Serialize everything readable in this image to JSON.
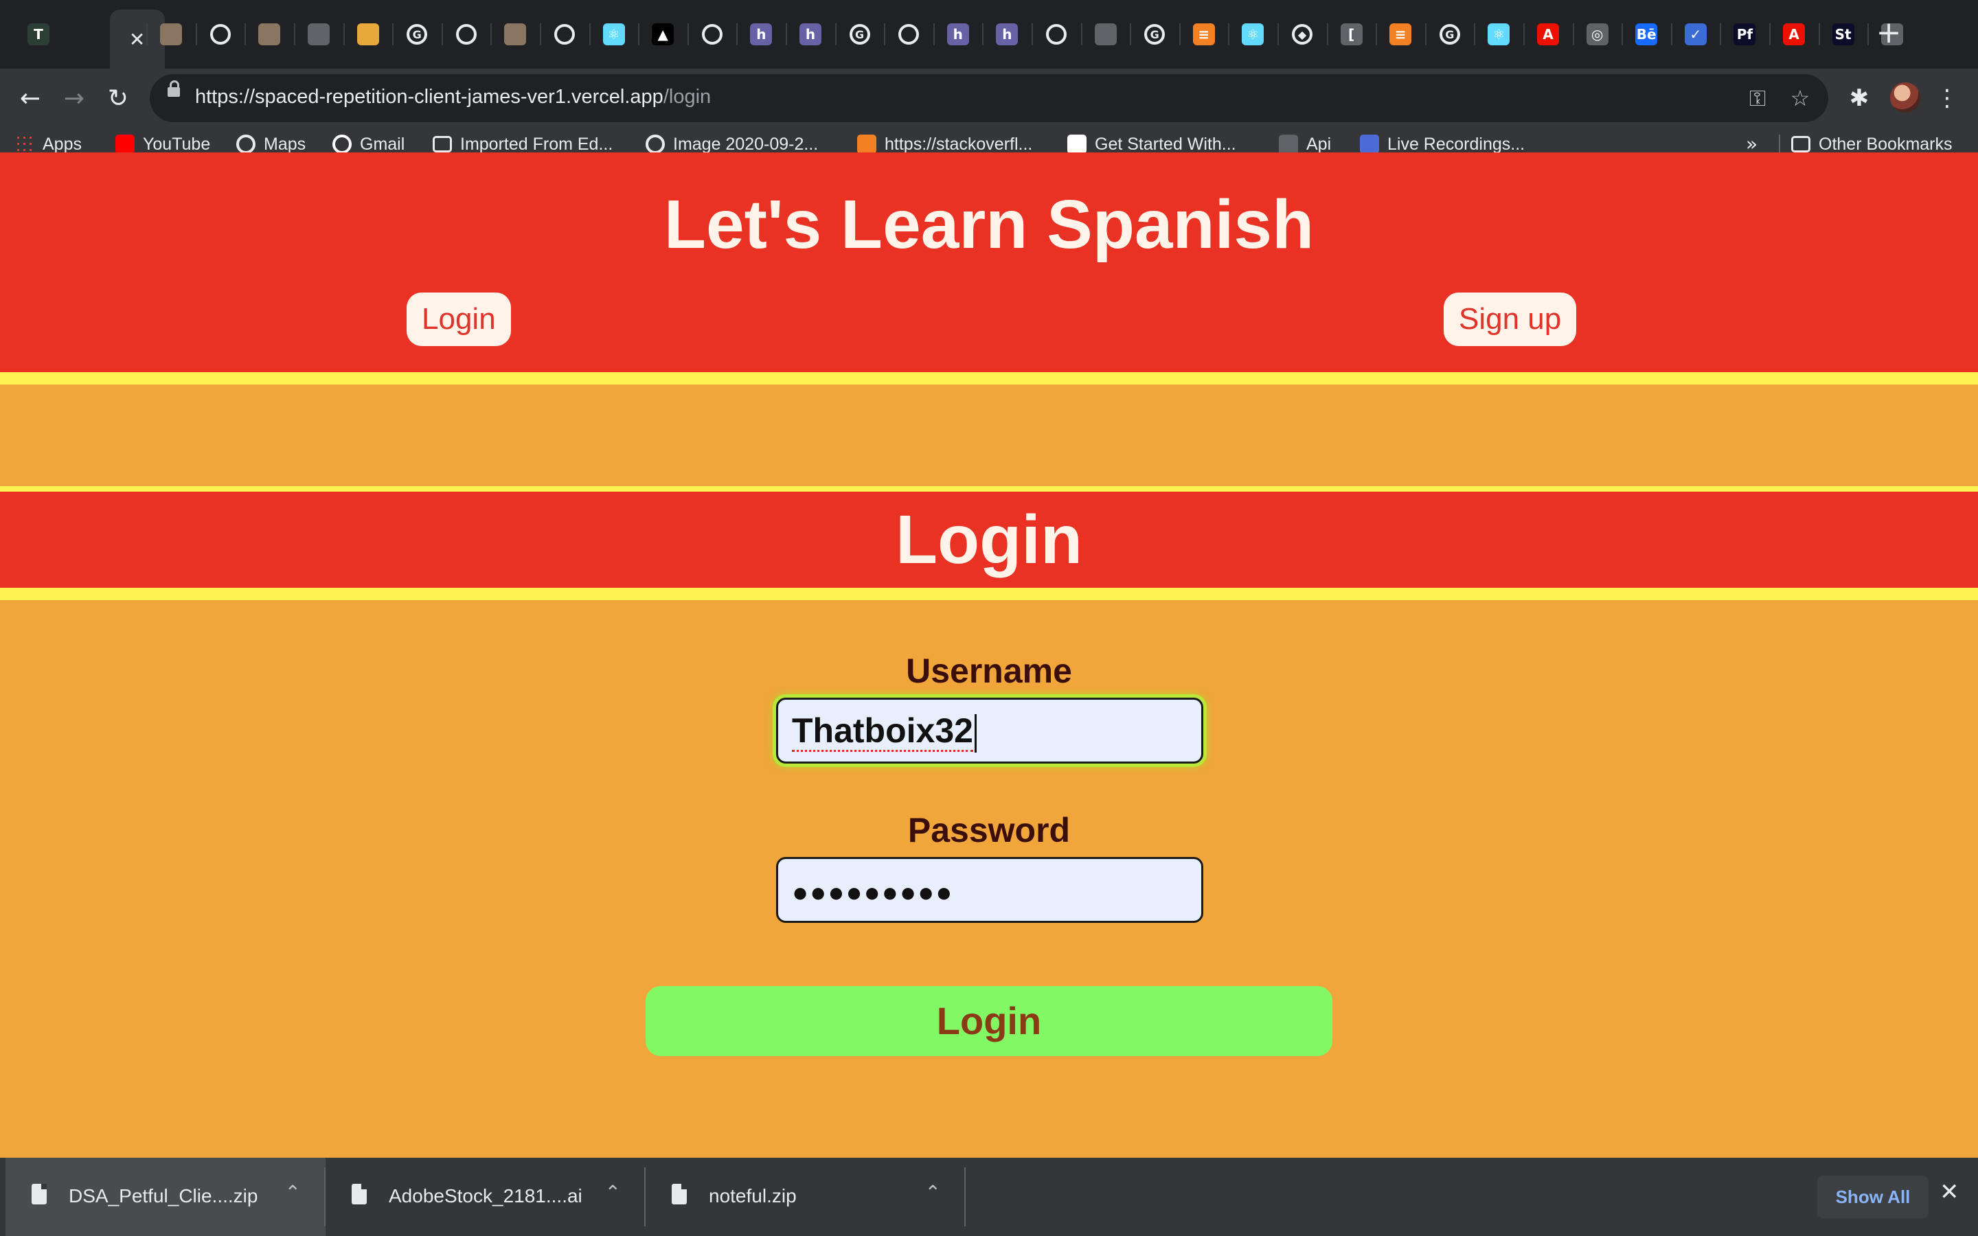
{
  "browser": {
    "tabs": [
      {
        "icon": "custom-app-icon",
        "color": "#2c3e35",
        "glyph": "T"
      },
      {
        "icon": "close-icon",
        "color": "#35363a",
        "glyph": "✕",
        "active": true
      },
      {
        "icon": "cat-photo-icon",
        "color": "#8a7560",
        "glyph": ""
      },
      {
        "icon": "github-icon",
        "color": "#ffffff",
        "glyph": ""
      },
      {
        "icon": "cat-photo-icon",
        "color": "#8a7560",
        "glyph": ""
      },
      {
        "icon": "globe-icon",
        "color": "#5f6368",
        "glyph": ""
      },
      {
        "icon": "shop-icon",
        "color": "#e8a93a",
        "glyph": ""
      },
      {
        "icon": "google-icon",
        "color": "#ffffff",
        "glyph": "G"
      },
      {
        "icon": "github-icon",
        "color": "#ffffff",
        "glyph": ""
      },
      {
        "icon": "cat-photo-icon",
        "color": "#8a7560",
        "glyph": ""
      },
      {
        "icon": "github-icon",
        "color": "#ffffff",
        "glyph": ""
      },
      {
        "icon": "react-icon",
        "color": "#61dafb",
        "glyph": "⚛"
      },
      {
        "icon": "vercel-icon",
        "color": "#000000",
        "glyph": "▲"
      },
      {
        "icon": "github-icon",
        "color": "#ffffff",
        "glyph": ""
      },
      {
        "icon": "heroku-icon",
        "color": "#6762a6",
        "glyph": "h"
      },
      {
        "icon": "heroku-icon",
        "color": "#6762a6",
        "glyph": "h"
      },
      {
        "icon": "google-icon",
        "color": "#ffffff",
        "glyph": "G"
      },
      {
        "icon": "github-icon",
        "color": "#ffffff",
        "glyph": ""
      },
      {
        "icon": "heroku-icon",
        "color": "#6762a6",
        "glyph": "h"
      },
      {
        "icon": "heroku-icon",
        "color": "#6762a6",
        "glyph": "h"
      },
      {
        "icon": "github-icon",
        "color": "#ffffff",
        "glyph": ""
      },
      {
        "icon": "globe-icon",
        "color": "#5f6368",
        "glyph": ""
      },
      {
        "icon": "google-icon",
        "color": "#ffffff",
        "glyph": "G"
      },
      {
        "icon": "stackoverflow-icon",
        "color": "#f48024",
        "glyph": "≡"
      },
      {
        "icon": "react-icon",
        "color": "#61dafb",
        "glyph": "⚛"
      },
      {
        "icon": "codepen-icon",
        "color": "#ffffff",
        "glyph": "◆"
      },
      {
        "icon": "api-icon",
        "color": "#5f6368",
        "glyph": "["
      },
      {
        "icon": "stackoverflow-icon",
        "color": "#f48024",
        "glyph": "≡"
      },
      {
        "icon": "google-icon",
        "color": "#ffffff",
        "glyph": "G"
      },
      {
        "icon": "react-icon",
        "color": "#61dafb",
        "glyph": "⚛"
      },
      {
        "icon": "adobe-icon",
        "color": "#eb1000",
        "glyph": "A"
      },
      {
        "icon": "dribbble-icon",
        "color": "#5f6368",
        "glyph": "◎"
      },
      {
        "icon": "behance-icon",
        "color": "#1769ff",
        "glyph": "Bē"
      },
      {
        "icon": "checkmark-icon",
        "color": "#3c6dd6",
        "glyph": "✓"
      },
      {
        "icon": "portfolio-icon",
        "color": "#0b0b2a",
        "glyph": "Pf"
      },
      {
        "icon": "adobe-icon",
        "color": "#eb1000",
        "glyph": "A"
      },
      {
        "icon": "stock-icon",
        "color": "#0b0b2a",
        "glyph": "St"
      },
      {
        "icon": "globe-icon",
        "color": "#5f6368",
        "glyph": ""
      }
    ],
    "url_main": "https://spaced-repetition-client-james-ver1.vercel.app",
    "url_path": "/login",
    "bookmarks": [
      {
        "label": "Apps",
        "icon": "apps-grid-icon",
        "color": "#4285f4"
      },
      {
        "label": "YouTube",
        "icon": "youtube-icon",
        "color": "#ff0000"
      },
      {
        "label": "Maps",
        "icon": "globe-icon",
        "color": "#e8eaed"
      },
      {
        "label": "Gmail",
        "icon": "google-icon",
        "color": "#ffffff"
      },
      {
        "label": "Imported From Ed...",
        "icon": "folder-icon",
        "color": "#e8eaed"
      },
      {
        "label": "Image 2020-09-2...",
        "icon": "globe-icon",
        "color": "#e8eaed"
      },
      {
        "label": "https://stackoverfl...",
        "icon": "stackoverflow-icon",
        "color": "#f48024"
      },
      {
        "label": "Get Started With...",
        "icon": "codepen-icon",
        "color": "#ffffff"
      },
      {
        "label": "Api",
        "icon": "api-icon",
        "color": "#5f6368"
      },
      {
        "label": "Live Recordings...",
        "icon": "recording-icon",
        "color": "#4d6bd6"
      }
    ],
    "overflow": "»",
    "other_bookmarks": "Other Bookmarks"
  },
  "page": {
    "site_title": "Let's Learn Spanish",
    "nav_login": "Login",
    "nav_signup": "Sign up",
    "heading": "Login",
    "username_label": "Username",
    "username_value": "Thatboix32",
    "password_label": "Password",
    "password_mask": "●●●●●●●●●",
    "submit_label": "Login",
    "colors": {
      "red": "#ea3224",
      "orange": "#f0a63a",
      "yellow": "#fdf251",
      "green": "#82f964"
    }
  },
  "downloads": {
    "items": [
      {
        "name": "DSA_Petful_Clie....zip"
      },
      {
        "name": "AdobeStock_2181....ai"
      },
      {
        "name": "noteful.zip"
      }
    ],
    "show_all": "Show All"
  }
}
